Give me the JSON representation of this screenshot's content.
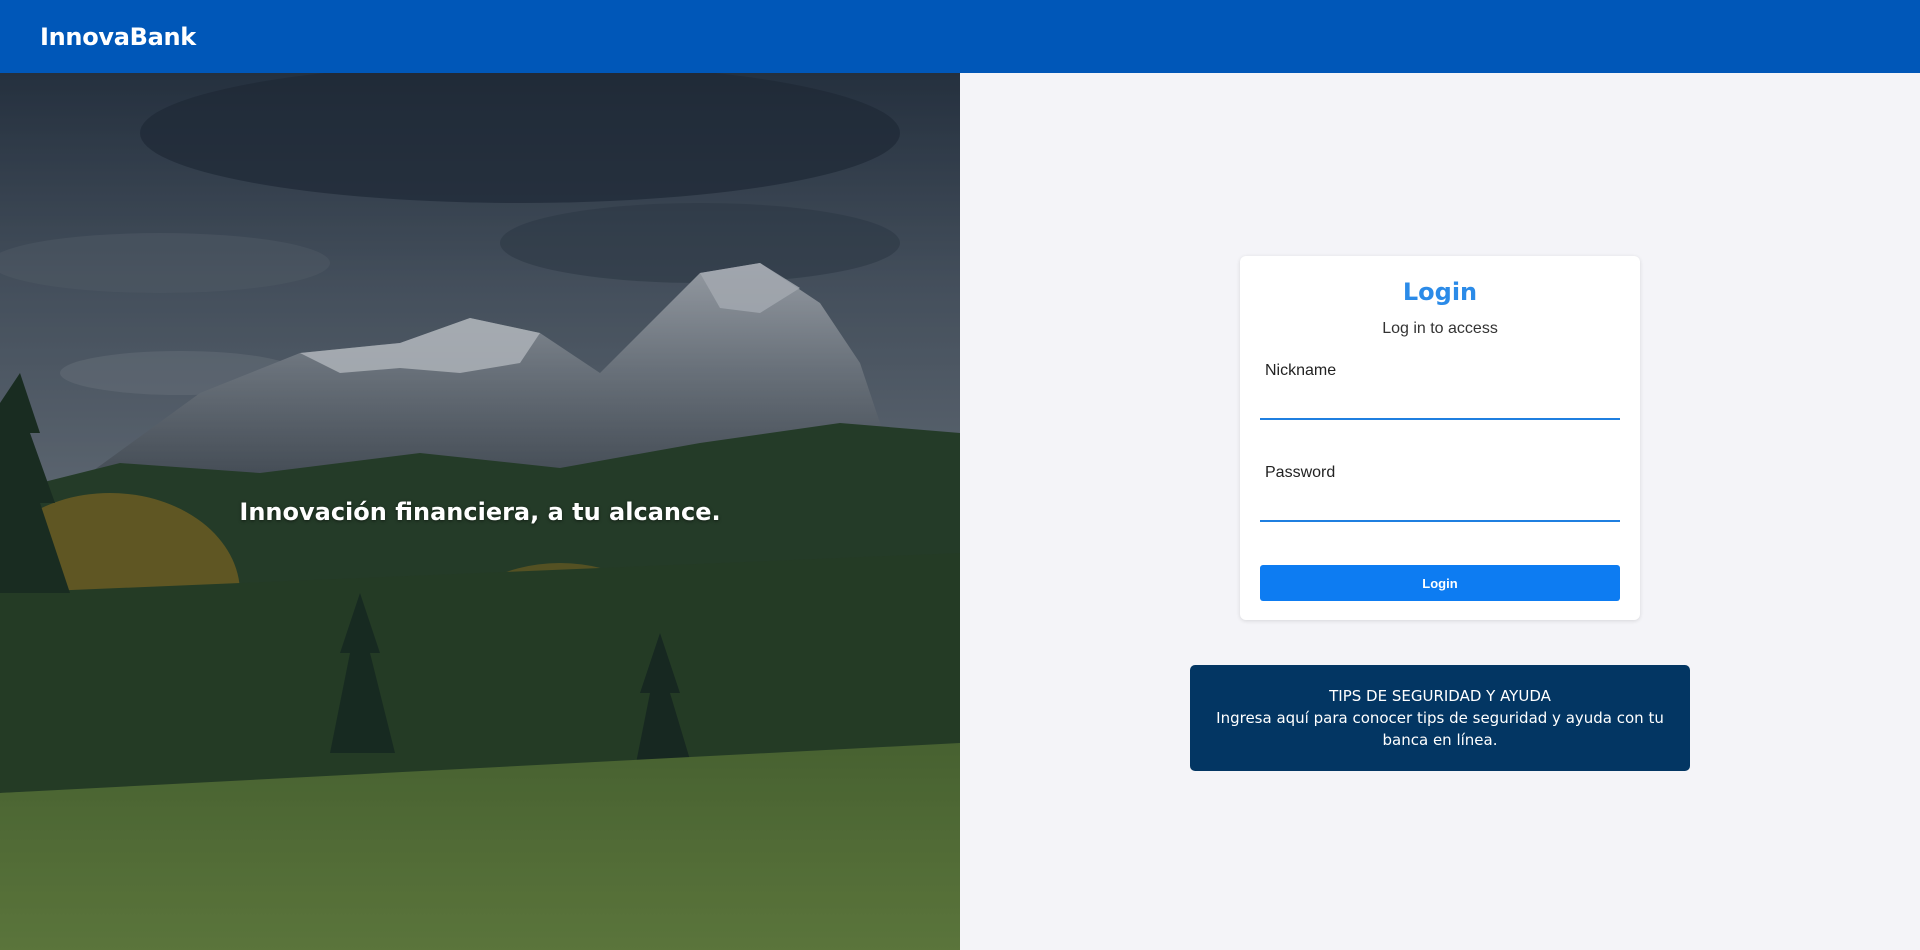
{
  "header": {
    "brand": "InnovaBank",
    "background_color": "#0057b8"
  },
  "hero": {
    "tagline": "Innovación financiera, a tu alcance.",
    "image_description_icon": "mountain-landscape-image"
  },
  "login": {
    "title": "Login",
    "subtitle": "Log in to access",
    "nickname_label": "Nickname",
    "nickname_value": "",
    "password_label": "Password",
    "password_value": "",
    "button_label": "Login",
    "accent_color": "#2b8be8",
    "button_color": "#0d7cf2"
  },
  "tips": {
    "title": "TIPS DE SEGURIDAD Y AYUDA",
    "body": "Ingresa aquí para conocer tips de seguridad y ayuda con tu banca en línea.",
    "background_color": "#033663"
  }
}
